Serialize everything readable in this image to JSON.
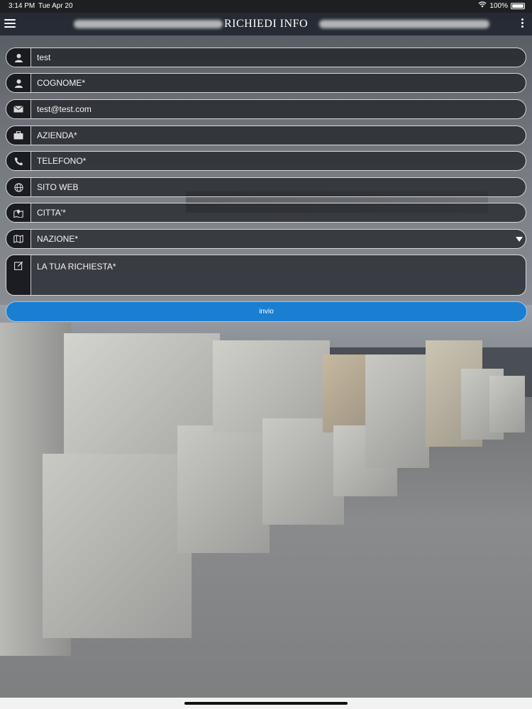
{
  "status_bar": {
    "time": "3:14 PM",
    "date": "Tue Apr 20",
    "battery": "100%",
    "icons": [
      "wifi-icon",
      "battery-icon"
    ]
  },
  "nav": {
    "title": "RICHIEDI INFO",
    "left_icon": "hamburger-menu-icon",
    "right_icon": "more-vertical-icon"
  },
  "form": {
    "fields": [
      {
        "icon": "person-icon",
        "value": "test"
      },
      {
        "icon": "person-icon",
        "value": "COGNOME*"
      },
      {
        "icon": "envelope-icon",
        "value": "test@test.com"
      },
      {
        "icon": "briefcase-icon",
        "value": "AZIENDA*"
      },
      {
        "icon": "phone-icon",
        "value": "TELEFONO*"
      },
      {
        "icon": "globe-icon",
        "value": "SITO WEB"
      },
      {
        "icon": "map-pin-icon",
        "value": "CITTA'*"
      },
      {
        "icon": "map-icon",
        "value": "NAZIONE*"
      },
      {
        "icon": "edit-icon",
        "value": "LA TUA RICHIESTA*"
      }
    ],
    "submit_label": "invio"
  },
  "colors": {
    "accent": "#1a7ed1",
    "field_bg": "#1c1e24",
    "navbar": "#141923"
  }
}
